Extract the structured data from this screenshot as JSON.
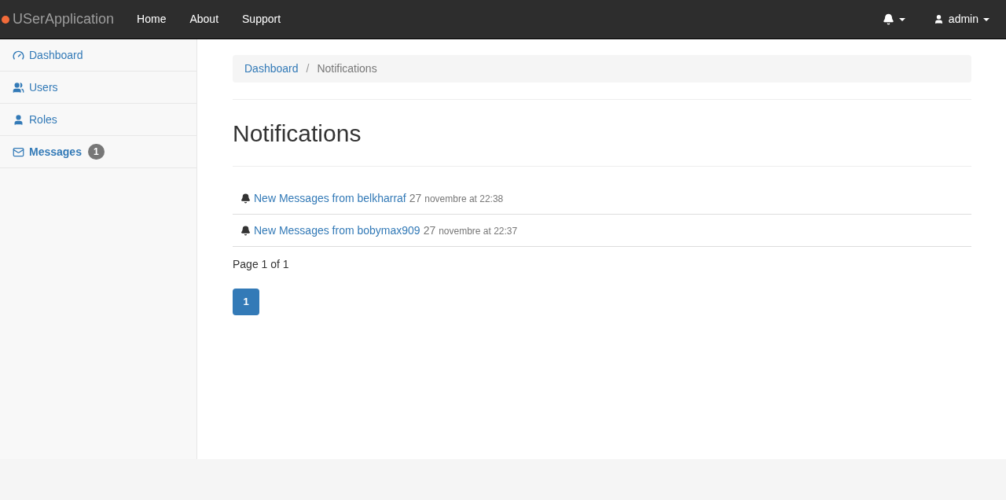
{
  "navbar": {
    "brand": "USerApplication",
    "links": [
      "Home",
      "About",
      "Support"
    ],
    "user": "admin"
  },
  "sidebar": {
    "items": [
      {
        "kind": "dashboard",
        "label": "Dashboard",
        "selected": false
      },
      {
        "kind": "users",
        "label": "Users",
        "selected": false
      },
      {
        "kind": "roles",
        "label": "Roles",
        "selected": false
      },
      {
        "kind": "messages",
        "label": "Messages",
        "selected": true,
        "badge": "1"
      }
    ]
  },
  "breadcrumb": [
    "Dashboard",
    "Notifications"
  ],
  "breadcrumb_separator": "/",
  "heading": "Notifications",
  "notifications": [
    {
      "text": "New Messages from belkharraf",
      "day": "27",
      "rest": "novembre at 22:38"
    },
    {
      "text": "New Messages from bobymax909",
      "day": "27",
      "rest": "novembre at 22:37"
    }
  ],
  "page_info": "Page 1 of 1",
  "pagination": [
    {
      "label": "1",
      "selected": true
    }
  ]
}
